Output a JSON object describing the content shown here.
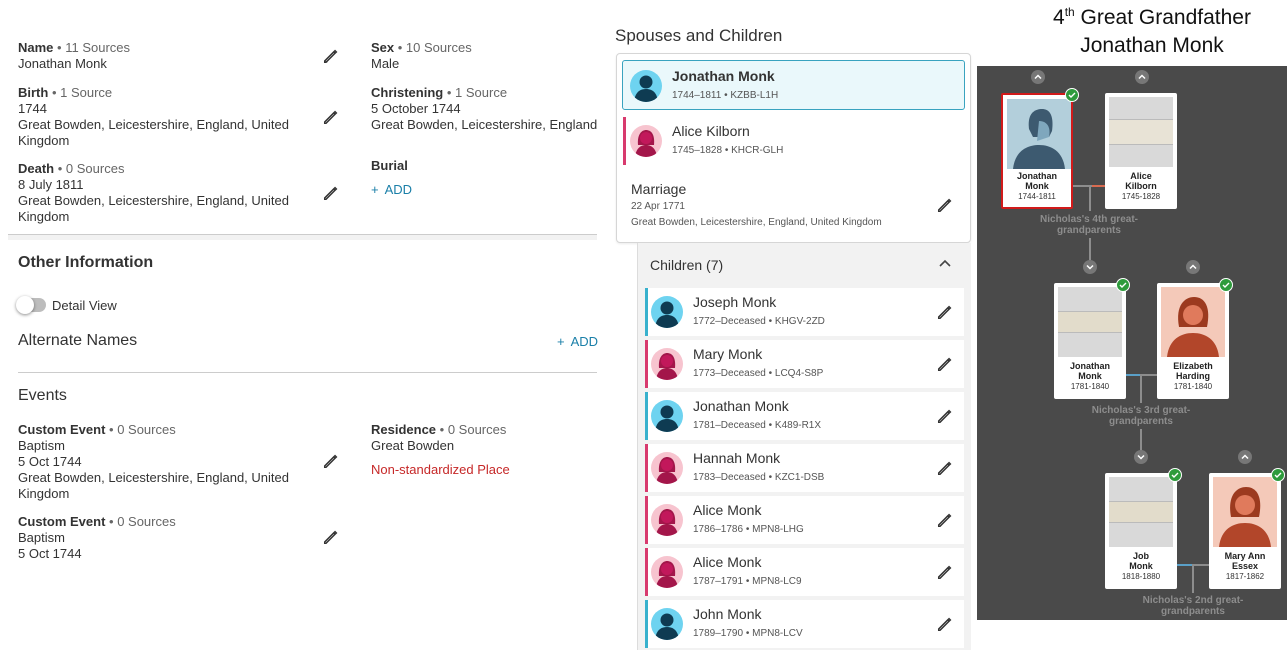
{
  "vitals": {
    "name": {
      "label": "Name",
      "sources": "• 11 Sources",
      "value": "Jonathan Monk"
    },
    "sex": {
      "label": "Sex",
      "sources": "• 10 Sources",
      "value": "Male"
    },
    "birth": {
      "label": "Birth",
      "sources": "• 1 Source",
      "date": "1744",
      "place1": "Great Bowden, Leicestershire, England, United",
      "place2": "Kingdom"
    },
    "christening": {
      "label": "Christening",
      "sources": "• 1 Source",
      "date": "5 October 1744",
      "place": "Great Bowden, Leicestershire, England"
    },
    "death": {
      "label": "Death",
      "sources": "• 0 Sources",
      "date": "8 July 1811",
      "place1": "Great Bowden, Leicestershire, England, United",
      "place2": "Kingdom"
    },
    "burial": {
      "label": "Burial",
      "add": "ADD"
    }
  },
  "other": {
    "title": "Other Information",
    "detail_view": "Detail View",
    "alt_names": "Alternate Names",
    "add": "ADD",
    "events_title": "Events"
  },
  "events": {
    "custom1": {
      "label": "Custom Event",
      "sources": "• 0 Sources",
      "type": "Baptism",
      "date": "5 Oct 1744",
      "place1": "Great Bowden, Leicestershire, England, United",
      "place2": "Kingdom"
    },
    "residence": {
      "label": "Residence",
      "sources": "• 0 Sources",
      "place": "Great Bowden",
      "warning": "Non-standardized Place"
    },
    "custom2": {
      "label": "Custom Event",
      "sources": "• 0 Sources",
      "type": "Baptism",
      "date": "5 Oct 1744"
    }
  },
  "spouses": {
    "title": "Spouses and Children",
    "husband": {
      "name": "Jonathan Monk",
      "meta": "1744–1811 • KZBB-L1H"
    },
    "wife": {
      "name": "Alice Kilborn",
      "meta": "1745–1828 • KHCR-GLH"
    },
    "marriage": {
      "title": "Marriage",
      "date": "22 Apr 1771",
      "place": "Great Bowden, Leicestershire, England, United Kingdom"
    }
  },
  "children": {
    "title": "Children (7)",
    "items": [
      {
        "name": "Joseph Monk",
        "meta": "1772–Deceased • KHGV-2ZD",
        "sex": "male"
      },
      {
        "name": "Mary Monk",
        "meta": "1773–Deceased • LCQ4-S8P",
        "sex": "female"
      },
      {
        "name": "Jonathan Monk",
        "meta": "1781–Deceased • K489-R1X",
        "sex": "male"
      },
      {
        "name": "Hannah Monk",
        "meta": "1783–Deceased • KZC1-DSB",
        "sex": "female"
      },
      {
        "name": "Alice Monk",
        "meta": "1786–1786 • MPN8-LHG",
        "sex": "female"
      },
      {
        "name": "Alice Monk",
        "meta": "1787–1791 • MPN8-LC9",
        "sex": "female"
      },
      {
        "name": "John Monk",
        "meta": "1789–1790 • MPN8-LCV",
        "sex": "male"
      }
    ]
  },
  "tree": {
    "title_num": "4",
    "title_sup": "th",
    "title_rest": " Great Grandfather",
    "title_name": "Jonathan Monk",
    "cards": {
      "jonathan1": {
        "name1": "Jonathan",
        "name2": "Monk",
        "years": "1744-1811"
      },
      "alice": {
        "name1": "Alice",
        "name2": "Kilborn",
        "years": "1745-1828"
      },
      "jonathan2": {
        "name1": "Jonathan",
        "name2": "Monk",
        "years": "1781-1840"
      },
      "elizabeth": {
        "name1": "Elizabeth",
        "name2": "Harding",
        "years": "1781-1840"
      },
      "job": {
        "name1": "Job",
        "name2": "Monk",
        "years": "1818-1880"
      },
      "maryann": {
        "name1": "Mary Ann",
        "name2": "Essex",
        "years": "1817-1862"
      }
    },
    "labels": {
      "gen4a": "Nicholas's 4th great-",
      "gen4b": "grandparents",
      "gen3a": "Nicholas's 3rd great-",
      "gen3b": "grandparents",
      "gen2a": "Nicholas's 2nd great-",
      "gen2b": "grandparents"
    }
  },
  "colors": {
    "accent": "#1a7fa8",
    "selected_border": "#39a3bf",
    "female_bar": "#d83a6e",
    "male_bar": "#38b1cd",
    "tree_bg": "#4a4a4a",
    "warning": "#c62828"
  }
}
